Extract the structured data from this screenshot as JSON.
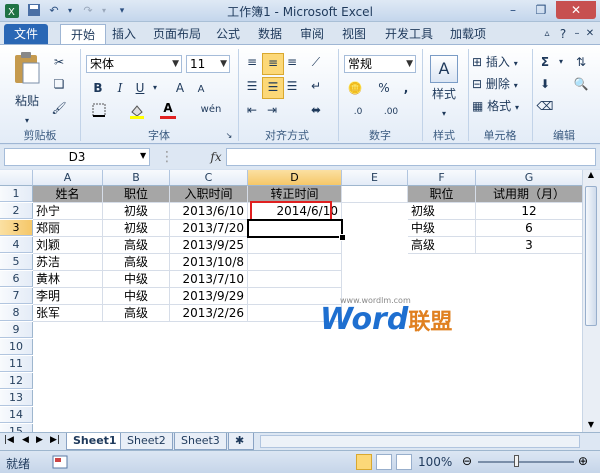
{
  "window": {
    "title": "工作簿1 - Microsoft Excel"
  },
  "ribbon_tabs": [
    "文件",
    "开始",
    "插入",
    "页面布局",
    "公式",
    "数据",
    "审阅",
    "视图",
    "开发工具",
    "加载项"
  ],
  "ribbon": {
    "clipboard": {
      "paste": "粘贴",
      "label": "剪贴板"
    },
    "font": {
      "name": "宋体",
      "size": "11",
      "label": "字体",
      "bold": "B",
      "italic": "I",
      "underline": "U",
      "grow": "A",
      "shrink": "A",
      "color": "A",
      "phonetic": "wén"
    },
    "alignment": {
      "label": "对齐方式"
    },
    "number": {
      "format": "常规",
      "label": "数字",
      "percent": "%",
      "comma": ",",
      "inc_decimal": ".0",
      "dec_decimal": ".00"
    },
    "styles": {
      "label": "样式",
      "button": "样式",
      "letter": "A"
    },
    "cells": {
      "insert": "插入",
      "delete": "删除",
      "format": "格式",
      "label": "单元格"
    },
    "editing": {
      "label": "编辑",
      "sum": "Σ"
    }
  },
  "formula_bar": {
    "name_box": "D3",
    "fx": "fx",
    "formula": ""
  },
  "columns": [
    "A",
    "B",
    "C",
    "D",
    "E",
    "F",
    "G"
  ],
  "rows": [
    "1",
    "2",
    "3",
    "4",
    "5",
    "6",
    "7",
    "8",
    "9",
    "10",
    "11",
    "12",
    "13",
    "14",
    "15"
  ],
  "table": {
    "headers": [
      "姓名",
      "职位",
      "入职时间",
      "转正时间"
    ],
    "data": [
      [
        "孙宁",
        "初级",
        "2013/6/10",
        "2014/6/10"
      ],
      [
        "郑丽",
        "初级",
        "2013/7/20",
        ""
      ],
      [
        "刘颖",
        "高级",
        "2013/9/25",
        ""
      ],
      [
        "苏洁",
        "高级",
        "2013/10/8",
        ""
      ],
      [
        "黄林",
        "中级",
        "2013/7/10",
        ""
      ],
      [
        "李明",
        "中级",
        "2013/9/29",
        ""
      ],
      [
        "张军",
        "高级",
        "2013/2/26",
        ""
      ]
    ]
  },
  "lookup": {
    "headers": [
      "职位",
      "试用期（月）"
    ],
    "data": [
      [
        "初级",
        "12"
      ],
      [
        "中级",
        "6"
      ],
      [
        "高级",
        "3"
      ]
    ]
  },
  "watermark": {
    "brand": "Word",
    "brand_cn": "联盟",
    "url": "www.wordlm.com"
  },
  "sheets": [
    "Sheet1",
    "Sheet2",
    "Sheet3"
  ],
  "status": {
    "mode": "就绪",
    "zoom": "100%"
  },
  "colors": {
    "accent": "#2a67b5",
    "header_fill": "#a6a6a6",
    "highlight": "#e02020",
    "watermark": "#1e6fd0"
  }
}
